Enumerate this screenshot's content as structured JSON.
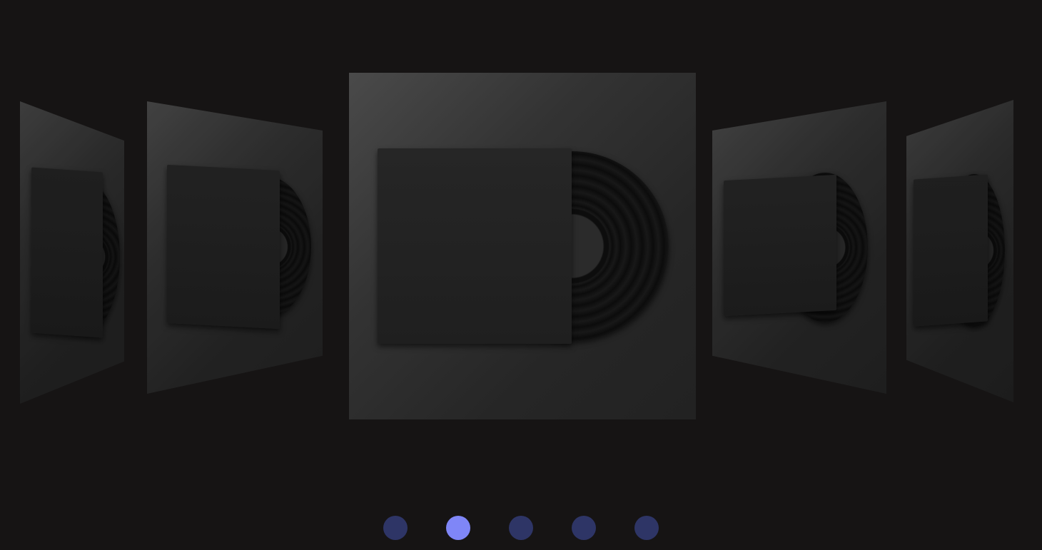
{
  "carousel": {
    "slides": [
      {
        "icon": "vinyl-record-icon"
      },
      {
        "icon": "vinyl-record-icon"
      },
      {
        "icon": "vinyl-record-icon",
        "active": true
      },
      {
        "icon": "vinyl-record-icon"
      },
      {
        "icon": "vinyl-record-icon"
      }
    ]
  },
  "pagination": {
    "count": 5,
    "active_index": 1,
    "colors": {
      "active": "#7f86f7",
      "inactive": "#2e3566"
    }
  },
  "theme": {
    "background": "#161414"
  }
}
